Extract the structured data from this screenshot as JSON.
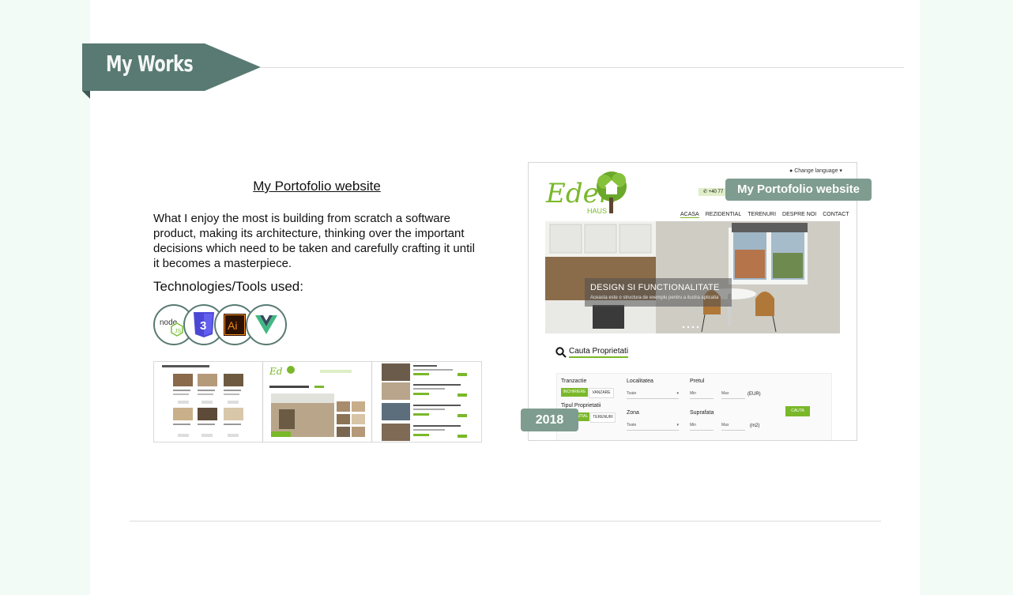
{
  "section": {
    "title": "My Works"
  },
  "project": {
    "title": "My Portofolio website",
    "description": "What I enjoy the most is building from scratch a software product, making its architecture, thinking over the important decisions which need to be taken and carefully crafting it until it becomes a masterpiece.",
    "tech_heading": "Technologies/Tools used:",
    "technologies": [
      {
        "name": "node-js-icon",
        "label": "node"
      },
      {
        "name": "css3-icon",
        "label": "3"
      },
      {
        "name": "adobe-illustrator-icon",
        "label": "Ai"
      },
      {
        "name": "vue-icon",
        "label": "V"
      }
    ],
    "overlay_title": "My Portofolio website",
    "year": "2018"
  },
  "screenshot": {
    "language": "Change language",
    "phone": "+40 77",
    "logo_text": "Eden",
    "logo_sub": "HAUS",
    "nav": [
      "ACASA",
      "REZIDENTIAL",
      "TERENURI",
      "DESPRE NOI",
      "CONTACT"
    ],
    "hero_title": "DESIGN SI FUNCTIONALITATE",
    "hero_sub": "Aceasta este o structura de exemplu pentru a ilustra aplicatia",
    "search_title": "Cauta Proprietati",
    "form": {
      "tranzactie": "Tranzactie",
      "inchiriere": "INCHIRIERE",
      "vanzare": "VANZARE",
      "localitatea": "Localitatea",
      "toate1": "Toate",
      "pretul": "Pretul",
      "min": "Min",
      "max": "Max",
      "eur": "(EUR)",
      "tipul": "Tipul Proprietatii",
      "rezidential": "REZIDENTIAL",
      "terenuri": "TERENURI",
      "zona": "Zona",
      "toate2": "Toate",
      "suprafata": "Suprafata",
      "m2": "(m2)",
      "cauta": "CAUTA"
    }
  },
  "colors": {
    "accent": "#587a72",
    "pill": "#7f9c90",
    "brand_green": "#7ab82a"
  }
}
